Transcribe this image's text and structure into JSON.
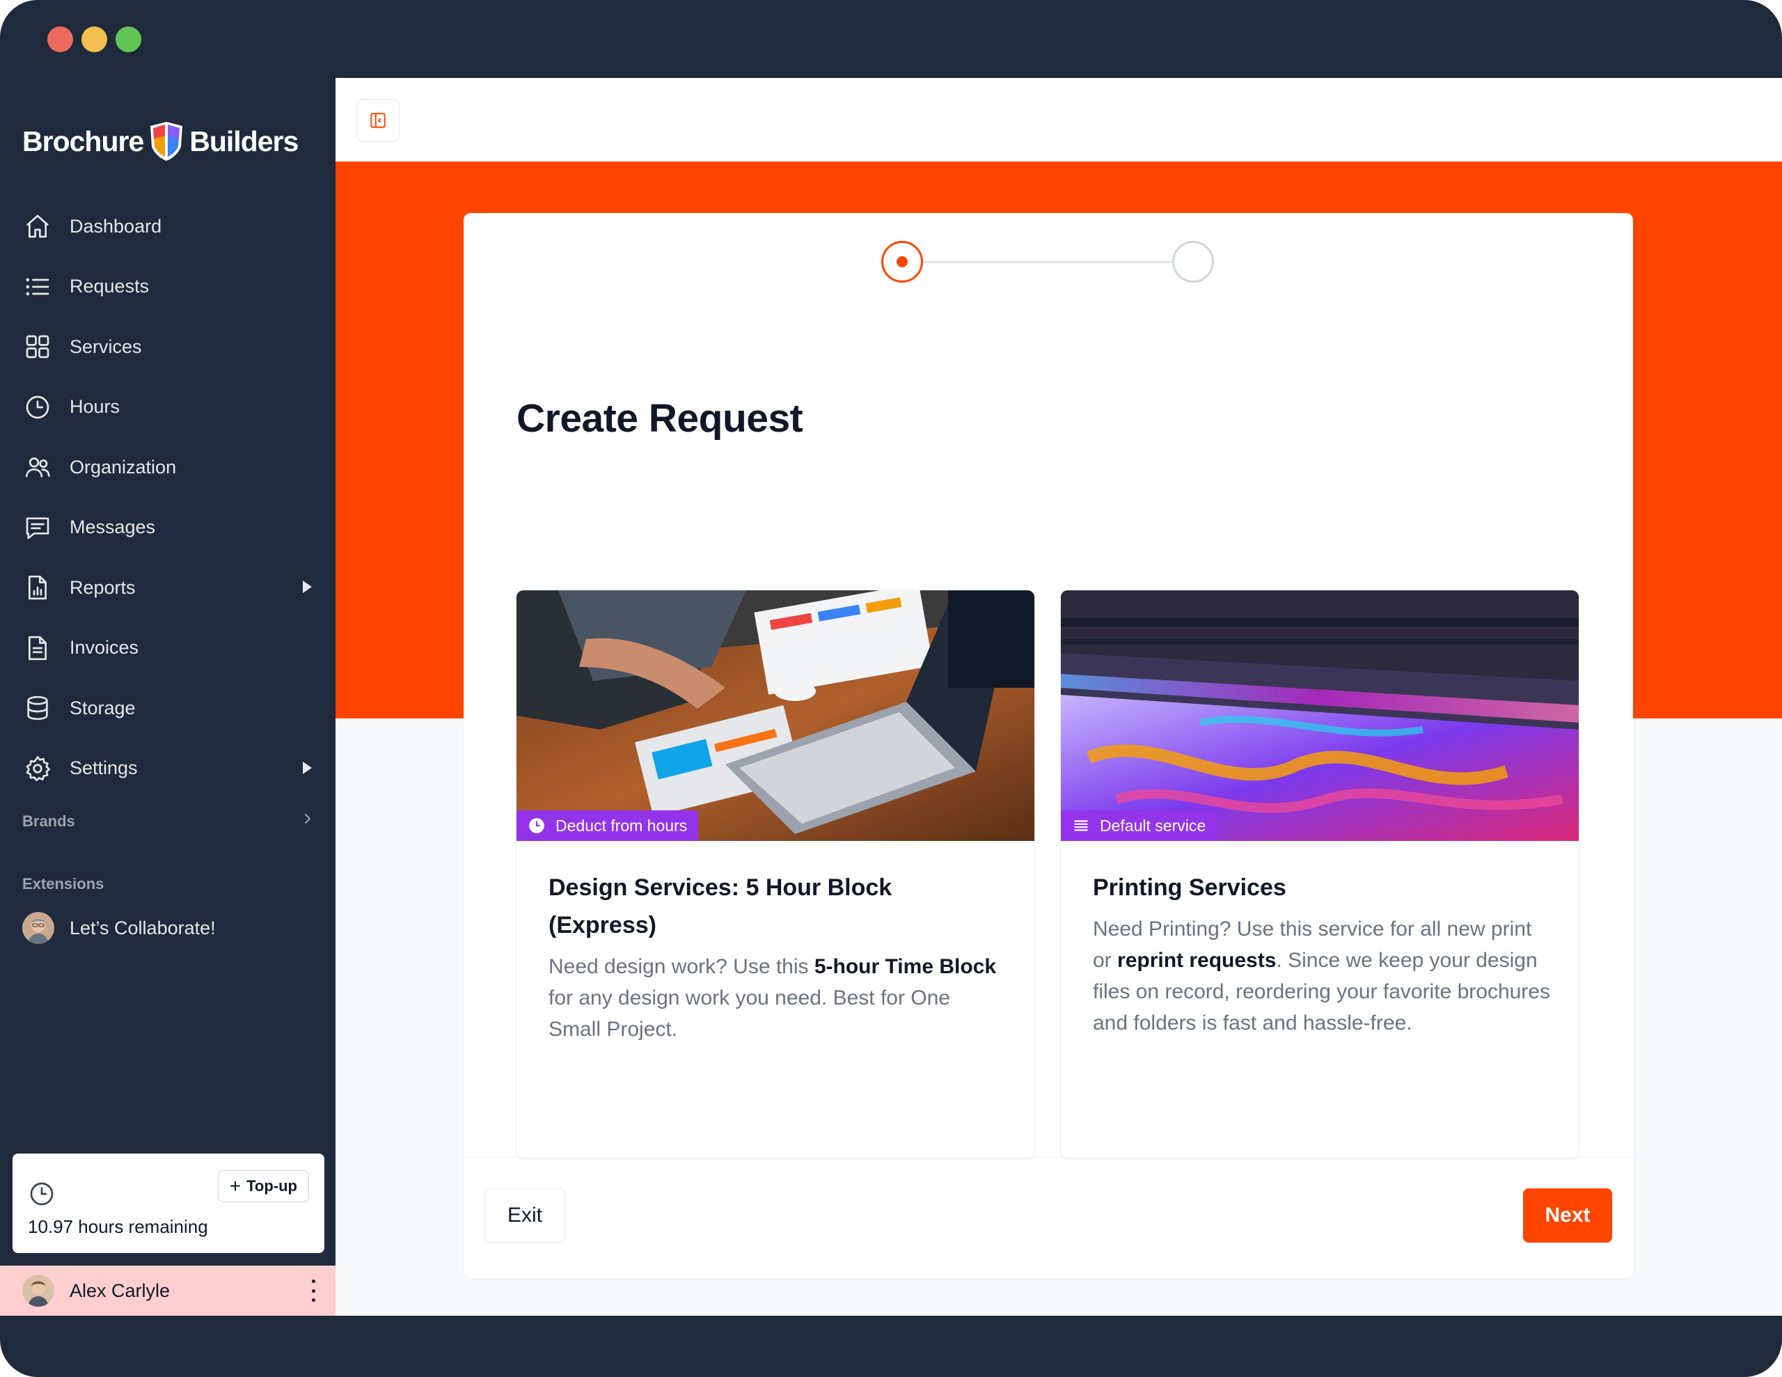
{
  "brand": {
    "name_left": "Brochure",
    "name_right": "Builders"
  },
  "sidebar": {
    "items": [
      {
        "label": "Dashboard",
        "icon": "home-icon"
      },
      {
        "label": "Requests",
        "icon": "list-icon"
      },
      {
        "label": "Services",
        "icon": "grid-icon"
      },
      {
        "label": "Hours",
        "icon": "clock-icon"
      },
      {
        "label": "Organization",
        "icon": "users-icon"
      },
      {
        "label": "Messages",
        "icon": "message-icon"
      },
      {
        "label": "Reports",
        "icon": "report-icon",
        "expandable": true
      },
      {
        "label": "Invoices",
        "icon": "invoice-icon"
      },
      {
        "label": "Storage",
        "icon": "database-icon"
      },
      {
        "label": "Settings",
        "icon": "gear-icon",
        "expandable": true
      }
    ],
    "brands_label": "Brands",
    "extensions_label": "Extensions",
    "extensions": [
      {
        "label": "Let’s Collaborate!"
      }
    ],
    "hours_card": {
      "topup_label": "Top-up",
      "remaining": "10.97 hours remaining"
    },
    "user": {
      "name": "Alex Carlyle"
    }
  },
  "wizard": {
    "title": "Create Request",
    "current_step": 1,
    "total_steps": 2,
    "cards": [
      {
        "badge": "Deduct from hours",
        "badge_icon": "clock-icon",
        "title": "Design Services: 5 Hour Block (Express)",
        "desc_1": "Need design work? Use this ",
        "desc_bold": "5-hour Time Block",
        "desc_2": " for any design work you need. Best for One Small Project."
      },
      {
        "badge": "Default service",
        "badge_icon": "list-icon",
        "title": "Printing Services",
        "desc_1": "Need Printing? Use this service for all new print or ",
        "desc_bold": "reprint requests",
        "desc_2": ". Since we keep your design files on record, reordering your favorite brochures and folders is fast and hassle-free."
      }
    ],
    "exit_label": "Exit",
    "next_label": "Next"
  },
  "colors": {
    "accent": "#ff4500",
    "sidebar": "#1f2a3c",
    "badge": "#9333ea",
    "user_row": "#ffcfcf"
  }
}
